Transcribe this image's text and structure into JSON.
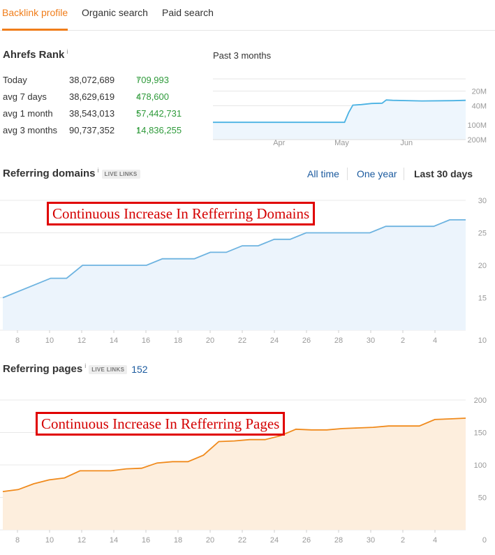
{
  "tabs": [
    {
      "label": "Backlink profile",
      "active": true
    },
    {
      "label": "Organic search",
      "active": false
    },
    {
      "label": "Paid search",
      "active": false
    }
  ],
  "rank": {
    "title": "Ahrefs Rank",
    "info": "i",
    "period": "Past 3 months",
    "rows": [
      {
        "label": "Today",
        "value": "38,072,689",
        "delta": "709,993"
      },
      {
        "label": "avg 7 days",
        "value": "38,629,619",
        "delta": "478,600"
      },
      {
        "label": "avg 1 month",
        "value": "38,543,013",
        "delta": "57,442,731"
      },
      {
        "label": "avg 3 months",
        "value": "90,737,352",
        "delta": "14,836,255"
      }
    ]
  },
  "referring_domains": {
    "title": "Referring domains",
    "info": "i",
    "badge": "LIVE LINKS",
    "ranges": [
      "All time",
      "One year",
      "Last 30 days"
    ],
    "active_range": "Last 30 days",
    "callout": "Continuous Increase In Refferring Domains"
  },
  "referring_pages": {
    "title": "Referring pages",
    "info": "i",
    "badge": "LIVE LINKS",
    "count": "152",
    "callout": "Continuous Increase In Refferring Pages"
  },
  "colors": {
    "accent": "#f07d1a",
    "positive": "#2e9a3a",
    "rank_line": "#4ab2e3",
    "domains_line": "#6db3e0",
    "pages_line": "#f08a1c",
    "callout_red": "#e00000"
  },
  "chart_data": [
    {
      "type": "line",
      "name": "ahrefs-rank",
      "x_ticks": [
        "Apr",
        "May",
        "Jun"
      ],
      "y_ticks": [
        "20M",
        "40M",
        "100M",
        "200M"
      ],
      "scale": "log",
      "inverted": true,
      "points": [
        {
          "x": "2023-03-02",
          "y": 88000000
        },
        {
          "x": "2023-05-04",
          "y": 88000000
        },
        {
          "x": "2023-05-06",
          "y": 55000000
        },
        {
          "x": "2023-05-08",
          "y": 39000000
        },
        {
          "x": "2023-05-12",
          "y": 38000000
        },
        {
          "x": "2023-05-17",
          "y": 36000000
        },
        {
          "x": "2023-05-22",
          "y": 35500000
        },
        {
          "x": "2023-05-24",
          "y": 30500000
        },
        {
          "x": "2023-05-27",
          "y": 31000000
        },
        {
          "x": "2023-06-10",
          "y": 32000000
        },
        {
          "x": "2023-06-25",
          "y": 31500000
        },
        {
          "x": "2023-07-01",
          "y": 31000000
        }
      ]
    },
    {
      "type": "area",
      "name": "referring-domains",
      "x_ticks": [
        "8",
        "10",
        "12",
        "14",
        "16",
        "18",
        "20",
        "22",
        "24",
        "26",
        "28",
        "30",
        "2",
        "4"
      ],
      "y_ticks": [
        10,
        15,
        20,
        25,
        30
      ],
      "ylim": [
        10,
        30
      ],
      "values": [
        15,
        16,
        17,
        18,
        18,
        20,
        20,
        20,
        20,
        20,
        21,
        21,
        21,
        22,
        22,
        23,
        23,
        24,
        24,
        25,
        25,
        25,
        25,
        25,
        26,
        26,
        26,
        26,
        27,
        27
      ]
    },
    {
      "type": "area",
      "name": "referring-pages",
      "x_ticks": [
        "8",
        "10",
        "12",
        "14",
        "16",
        "18",
        "20",
        "22",
        "24",
        "26",
        "28",
        "30",
        "2",
        "4"
      ],
      "y_ticks": [
        0,
        50,
        100,
        150,
        200
      ],
      "ylim": [
        0,
        200
      ],
      "values": [
        59,
        62,
        71,
        77,
        80,
        91,
        91,
        91,
        94,
        95,
        103,
        105,
        105,
        115,
        136,
        137,
        139,
        139,
        145,
        155,
        154,
        154,
        156,
        157,
        158,
        160,
        160,
        160,
        170,
        171,
        172
      ]
    }
  ]
}
